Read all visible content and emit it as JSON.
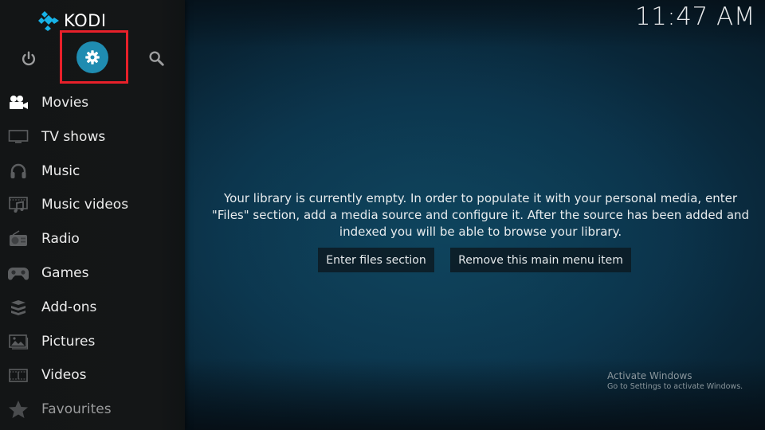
{
  "app": {
    "name": "KODI",
    "clock": "11:47 AM"
  },
  "top_icons": [
    {
      "name": "power",
      "icon": "power-icon"
    },
    {
      "name": "settings",
      "icon": "gear-icon",
      "selected": true
    },
    {
      "name": "search",
      "icon": "search-icon"
    }
  ],
  "sidebar": {
    "items": [
      {
        "label": "Movies",
        "icon": "movie-camera-icon"
      },
      {
        "label": "TV shows",
        "icon": "tv-icon"
      },
      {
        "label": "Music",
        "icon": "headphones-icon"
      },
      {
        "label": "Music videos",
        "icon": "music-video-icon"
      },
      {
        "label": "Radio",
        "icon": "radio-icon"
      },
      {
        "label": "Games",
        "icon": "gamepad-icon"
      },
      {
        "label": "Add-ons",
        "icon": "addons-box-icon"
      },
      {
        "label": "Pictures",
        "icon": "picture-icon"
      },
      {
        "label": "Videos",
        "icon": "film-strip-icon"
      },
      {
        "label": "Favourites",
        "icon": "star-icon"
      }
    ]
  },
  "main": {
    "message_line1": "Your library is currently empty. In order to populate it with your personal media, enter",
    "message_line2": "\"Files\" section, add a media source and configure it. After the source has been added and",
    "message_line3": "indexed you will be able to browse your library.",
    "enter_files_label": "Enter files section",
    "remove_item_label": "Remove this main menu item"
  },
  "watermark": {
    "title": "Activate Windows",
    "subtitle": "Go to Settings to activate Windows."
  },
  "colors": {
    "accent": "#1f8cb1",
    "highlight_box": "#e8202a",
    "logo": "#17b2e7"
  }
}
